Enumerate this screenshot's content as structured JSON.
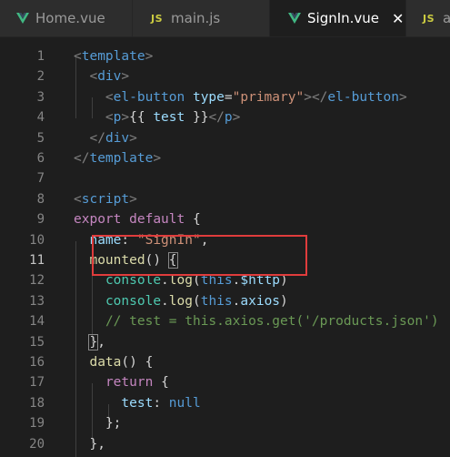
{
  "tabs": [
    {
      "label": "Home.vue",
      "icon": "vue-icon",
      "active": false
    },
    {
      "label": "main.js",
      "icon": "js-icon",
      "active": false
    },
    {
      "label": "SignIn.vue",
      "icon": "vue-icon",
      "active": true
    },
    {
      "label": "a",
      "icon": "js-icon",
      "active": false
    }
  ],
  "js_icon_text": "JS",
  "close_glyph": "✕",
  "colors": {
    "vue_green": "#41b883",
    "highlight_box": "#e03c3c",
    "editor_bg": "#1e1e1e"
  },
  "editor": {
    "current_line": "11",
    "lines": [
      {
        "n": "1",
        "code": "<template>"
      },
      {
        "n": "2",
        "code": "  <div>"
      },
      {
        "n": "3",
        "code": "    <el-button type=\"primary\"></el-button>"
      },
      {
        "n": "4",
        "code": "    <p>{{ test }}</p>"
      },
      {
        "n": "5",
        "code": "  </div>"
      },
      {
        "n": "6",
        "code": "</template>"
      },
      {
        "n": "7",
        "code": ""
      },
      {
        "n": "8",
        "code": "<script>"
      },
      {
        "n": "9",
        "code": "export default {"
      },
      {
        "n": "10",
        "code": "  name: \"SignIn\","
      },
      {
        "n": "11",
        "code": "  mounted() {"
      },
      {
        "n": "12",
        "code": "    console.log(this.$http)"
      },
      {
        "n": "13",
        "code": "    console.log(this.axios)"
      },
      {
        "n": "14",
        "code": "    // test = this.axios.get('/products.json')"
      },
      {
        "n": "15",
        "code": "  },"
      },
      {
        "n": "16",
        "code": "  data() {"
      },
      {
        "n": "17",
        "code": "    return {"
      },
      {
        "n": "18",
        "code": "      test: null"
      },
      {
        "n": "19",
        "code": "    };"
      },
      {
        "n": "20",
        "code": "  },"
      }
    ]
  }
}
